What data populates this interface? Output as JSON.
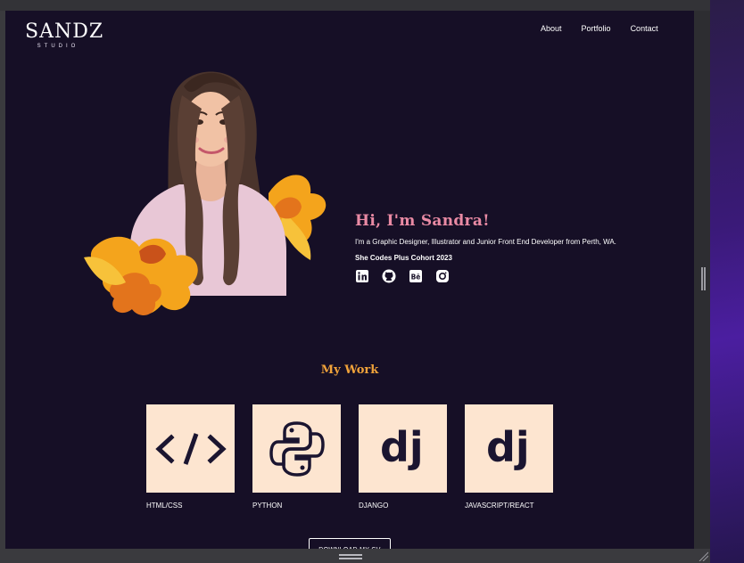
{
  "site": {
    "logo": {
      "main": "SANDZ",
      "sub": "STUDIO"
    },
    "nav": [
      {
        "label": "About"
      },
      {
        "label": "Portfolio"
      },
      {
        "label": "Contact"
      }
    ],
    "hero": {
      "title": "Hi, I'm Sandra!",
      "description": "I'm a Graphic Designer, Illustrator and Junior Front End Developer from Perth, WA.",
      "cohort": "She Codes Plus Cohort 2023",
      "socials": [
        "linkedin-icon",
        "github-icon",
        "behance-icon",
        "instagram-icon"
      ]
    },
    "work": {
      "title": "My Work",
      "cards": [
        {
          "label": "HTML/CSS",
          "icon": "code-icon"
        },
        {
          "label": "PYTHON",
          "icon": "python-icon"
        },
        {
          "label": "DJANGO",
          "icon": "django-icon",
          "glyph": "dj"
        },
        {
          "label": "JAVASCRIPT/REACT",
          "icon": "django-icon",
          "glyph": "dj"
        }
      ]
    },
    "cv_button": "DOWNLOAD MY CV"
  },
  "colors": {
    "background": "#160f26",
    "accent_pink": "#e98aa4",
    "accent_orange": "#f0a23a",
    "card": "#fde5d0"
  }
}
